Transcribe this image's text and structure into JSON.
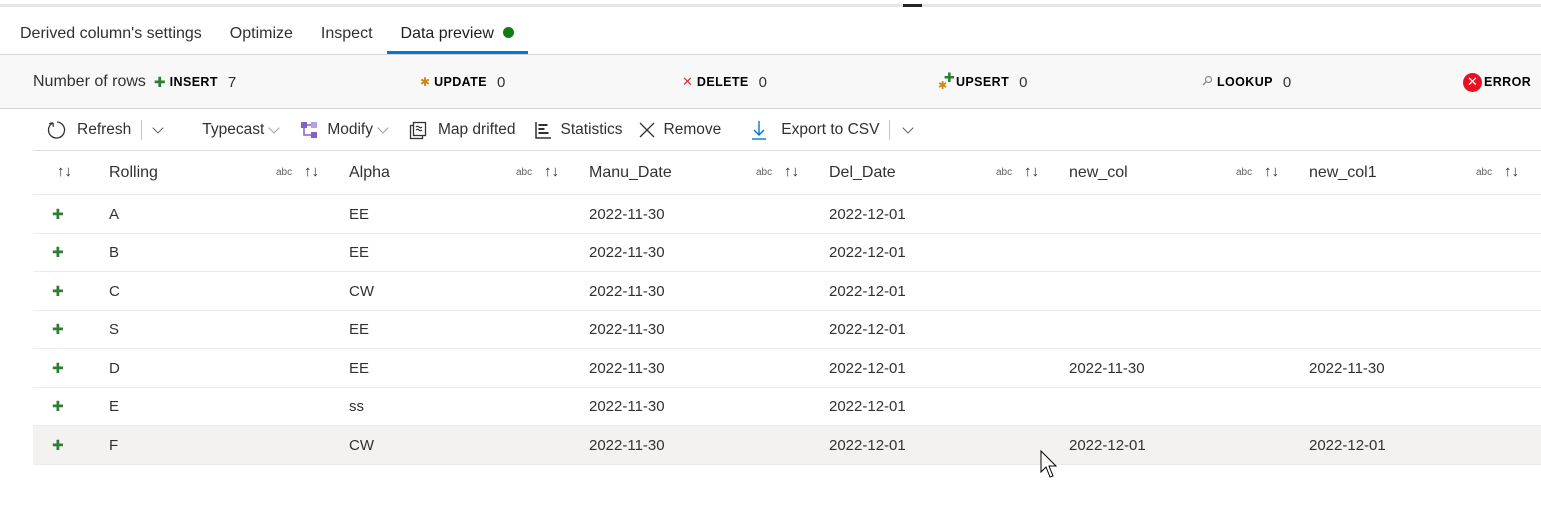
{
  "tabs": [
    {
      "label": "Derived column's settings",
      "active": false
    },
    {
      "label": "Optimize",
      "active": false
    },
    {
      "label": "Inspect",
      "active": false
    },
    {
      "label": "Data preview",
      "active": true,
      "status_color": "#107c10"
    }
  ],
  "stats": {
    "title": "Number of rows",
    "insert": {
      "label": "INSERT",
      "count": "7",
      "icon": "plus-icon"
    },
    "update": {
      "label": "UPDATE",
      "count": "0",
      "icon": "asterisk-icon"
    },
    "delete": {
      "label": "DELETE",
      "count": "0",
      "icon": "x-icon"
    },
    "upsert": {
      "label": "UPSERT",
      "count": "0",
      "icon": "upsert-icon"
    },
    "lookup": {
      "label": "LOOKUP",
      "count": "0",
      "icon": "search-icon"
    },
    "error": {
      "label": "ERROR",
      "icon": "error-icon"
    }
  },
  "toolbar": {
    "refresh": "Refresh",
    "typecast": "Typecast",
    "modify": "Modify",
    "map_drifted": "Map drifted",
    "statistics": "Statistics",
    "remove": "Remove",
    "export_csv": "Export to CSV"
  },
  "grid": {
    "columns": [
      {
        "name": "Rolling",
        "type": "abc"
      },
      {
        "name": "Alpha",
        "type": "abc"
      },
      {
        "name": "Manu_Date",
        "type": "abc"
      },
      {
        "name": "Del_Date",
        "type": "abc"
      },
      {
        "name": "new_col",
        "type": "abc"
      },
      {
        "name": "new_col1",
        "type": "abc"
      }
    ],
    "rows": [
      {
        "marker": "+",
        "cells": [
          "A",
          "EE",
          "2022-11-30",
          "2022-12-01",
          "",
          ""
        ]
      },
      {
        "marker": "+",
        "cells": [
          "B",
          "EE",
          "2022-11-30",
          "2022-12-01",
          "",
          ""
        ]
      },
      {
        "marker": "+",
        "cells": [
          "C",
          "CW",
          "2022-11-30",
          "2022-12-01",
          "",
          ""
        ]
      },
      {
        "marker": "+",
        "cells": [
          "S",
          "EE",
          "2022-11-30",
          "2022-12-01",
          "",
          ""
        ]
      },
      {
        "marker": "+",
        "cells": [
          "D",
          "EE",
          "2022-11-30",
          "2022-12-01",
          "2022-11-30",
          "2022-11-30"
        ]
      },
      {
        "marker": "+",
        "cells": [
          "E",
          "ss",
          "2022-11-30",
          "2022-12-01",
          "",
          ""
        ]
      },
      {
        "marker": "+",
        "cells": [
          "F",
          "CW",
          "2022-11-30",
          "2022-12-01",
          "2022-12-01",
          "2022-12-01"
        ]
      }
    ],
    "hovered_row": 6
  }
}
